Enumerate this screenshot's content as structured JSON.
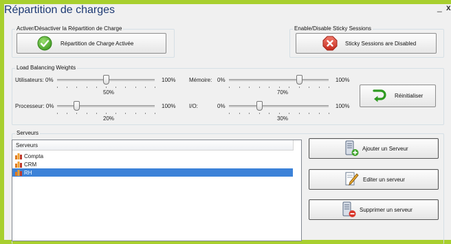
{
  "window": {
    "title": "Répartition de charges",
    "minimize_glyph": "_",
    "close_glyph": "x"
  },
  "activation": {
    "group_label": "Activer/Désactiver la Répartition de Charge",
    "button_label": "Répartition de Charge Activée",
    "icon": "green-check-icon",
    "icon_color": "#5cb03a"
  },
  "sticky": {
    "group_label": "Enable/Disable Sticky Sessions",
    "button_label": "Sticky Sessions are Disabled",
    "icon": "red-x-icon",
    "icon_color": "#d9362b"
  },
  "weights": {
    "group_label": "Load Balancing Weights",
    "sliders": [
      {
        "label": "Utilisateurs: 0%",
        "max_label": "100%",
        "value": 50,
        "value_label": "50%"
      },
      {
        "label": "Mémoire:",
        "min_label": "0%",
        "max_label": "100%",
        "value": 70,
        "value_label": "70%"
      },
      {
        "label": "Processeur: 0%",
        "max_label": "100%",
        "value": 20,
        "value_label": "20%"
      },
      {
        "label": "I/O:",
        "min_label": "0%",
        "max_label": "100%",
        "value": 30,
        "value_label": "30%"
      }
    ],
    "reset_label": "Réinitialiser",
    "reset_icon": "green-arrow-icon"
  },
  "servers": {
    "group_label": "Serveurs",
    "column_header": "Serveurs",
    "items": [
      {
        "name": "Compta",
        "selected": false
      },
      {
        "name": "CRM",
        "selected": false
      },
      {
        "name": "RH",
        "selected": true
      }
    ],
    "add_label": "Ajouter un Serveur",
    "edit_label": "Editer un serveur",
    "delete_label": "Supprimer un serveur"
  },
  "colors": {
    "accent": "#a8cf2e",
    "title": "#1d3a73",
    "selection": "#3c82d8"
  }
}
